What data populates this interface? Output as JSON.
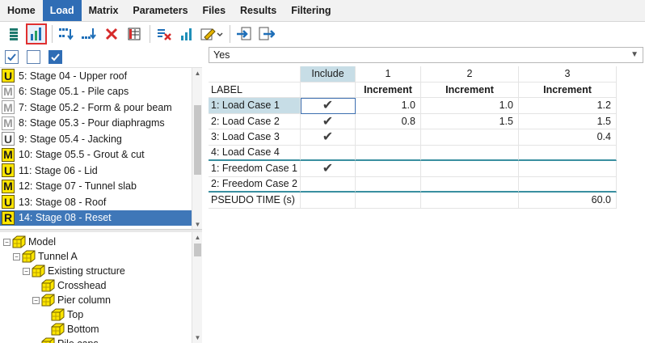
{
  "menu": {
    "items": [
      "Home",
      "Load",
      "Matrix",
      "Parameters",
      "Files",
      "Results",
      "Filtering"
    ],
    "active_index": 1
  },
  "toolbar": {
    "icons": [
      "stack-icon",
      "bar-chart-icon",
      "sort-down-icon",
      "sort-down-alt-icon",
      "delete-x-icon",
      "table-color-icon",
      "clear-table-icon",
      "bar-chart-blue-icon",
      "edit-dropdown-icon",
      "import-icon",
      "export-icon"
    ],
    "selected_icon": "bar-chart-icon",
    "accent": "#e03030"
  },
  "filter_checks": [
    true,
    false,
    true
  ],
  "stages": [
    {
      "badge": "U",
      "label": "5: Stage 04 - Upper roof",
      "style": "yellow"
    },
    {
      "badge": "M",
      "label": "6: Stage 05.1 - Pile caps",
      "style": "gray"
    },
    {
      "badge": "M",
      "label": "7: Stage 05.2 - Form & pour beam",
      "style": "gray"
    },
    {
      "badge": "M",
      "label": "8: Stage 05.3 - Pour diaphragms",
      "style": "gray"
    },
    {
      "badge": "U",
      "label": "9: Stage 05.4 - Jacking",
      "style": "white"
    },
    {
      "badge": "M",
      "label": "10: Stage 05.5 - Grout & cut",
      "style": "yellow"
    },
    {
      "badge": "U",
      "label": "11: Stage 06 - Lid",
      "style": "yellow"
    },
    {
      "badge": "M",
      "label": "12: Stage 07 - Tunnel slab",
      "style": "yellow"
    },
    {
      "badge": "U",
      "label": "13: Stage 08 - Roof",
      "style": "yellow"
    },
    {
      "badge": "R",
      "label": "14: Stage 08 - Reset",
      "style": "yellow",
      "selected": true
    }
  ],
  "tree": [
    {
      "label": "Model",
      "level": 0,
      "expander": "−"
    },
    {
      "label": "Tunnel A",
      "level": 1,
      "expander": "−"
    },
    {
      "label": "Existing structure",
      "level": 2,
      "expander": "−"
    },
    {
      "label": "Crosshead",
      "level": 3,
      "expander": ""
    },
    {
      "label": "Pier column",
      "level": 3,
      "expander": "−"
    },
    {
      "label": "Top",
      "level": 4,
      "expander": ""
    },
    {
      "label": "Bottom",
      "level": 4,
      "expander": ""
    },
    {
      "label": "Pile caps",
      "level": 3,
      "expander": ""
    }
  ],
  "selector": {
    "value": "Yes"
  },
  "grid": {
    "col_headers": [
      "",
      "Include",
      "1",
      "2",
      "3"
    ],
    "subheader": [
      "LABEL",
      "",
      "Increment",
      "Increment",
      "Increment"
    ],
    "rows": [
      {
        "label": "1: Load Case 1",
        "include": true,
        "v1": "1.0",
        "v2": "1.0",
        "v3": "1.2",
        "highlight": true
      },
      {
        "label": "2: Load Case 2",
        "include": true,
        "v1": "0.8",
        "v2": "1.5",
        "v3": "1.5"
      },
      {
        "label": "3: Load Case 3",
        "include": true,
        "v1": "",
        "v2": "",
        "v3": "0.4"
      },
      {
        "label": "4: Load Case 4",
        "include": false,
        "v1": "",
        "v2": "",
        "v3": "",
        "separator": true
      },
      {
        "label": "1: Freedom Case 1",
        "include": true,
        "v1": "",
        "v2": "",
        "v3": ""
      },
      {
        "label": "2: Freedom Case 2",
        "include": false,
        "v1": "",
        "v2": "",
        "v3": "",
        "separator": true
      },
      {
        "label": "PSEUDO TIME (s)",
        "include": false,
        "v1": "",
        "v2": "",
        "v3": "60.0"
      }
    ],
    "check_glyph": "✔"
  }
}
